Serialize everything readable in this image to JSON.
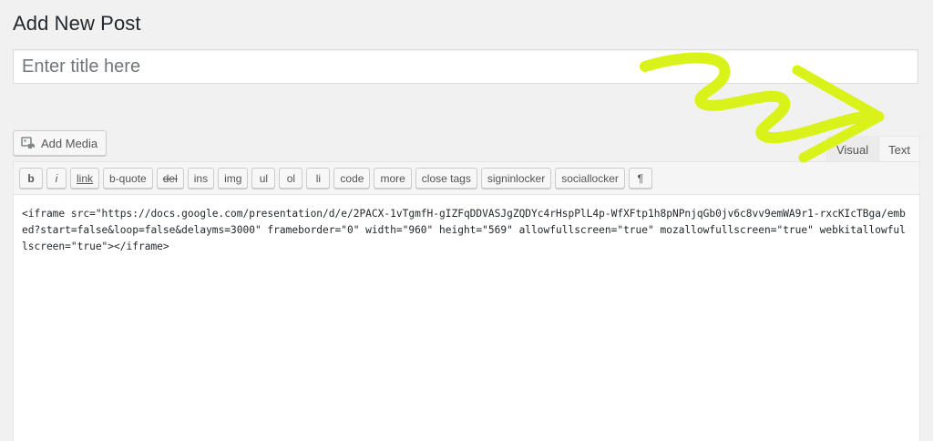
{
  "page": {
    "title": "Add New Post"
  },
  "title_field": {
    "placeholder": "Enter title here",
    "value": ""
  },
  "media": {
    "add_media_label": "Add Media",
    "icon": "media-icon"
  },
  "tabs": [
    {
      "label": "Visual",
      "active": false
    },
    {
      "label": "Text",
      "active": true
    }
  ],
  "quicktags": [
    {
      "label": "b",
      "style": "bold"
    },
    {
      "label": "i",
      "style": "ital"
    },
    {
      "label": "link",
      "style": "link"
    },
    {
      "label": "b-quote",
      "style": ""
    },
    {
      "label": "del",
      "style": "del"
    },
    {
      "label": "ins",
      "style": ""
    },
    {
      "label": "img",
      "style": ""
    },
    {
      "label": "ul",
      "style": "sq"
    },
    {
      "label": "ol",
      "style": "sq"
    },
    {
      "label": "li",
      "style": "sq"
    },
    {
      "label": "code",
      "style": ""
    },
    {
      "label": "more",
      "style": ""
    },
    {
      "label": "close tags",
      "style": ""
    },
    {
      "label": "signinlocker",
      "style": ""
    },
    {
      "label": "sociallocker",
      "style": ""
    },
    {
      "label": "¶",
      "style": "sq"
    }
  ],
  "editor": {
    "content": "<iframe src=\"https://docs.google.com/presentation/d/e/2PACX-1vTgmfH-gIZFqDDVASJgZQDYc4rHspPlL4p-WfXFtp1h8pNPnjqGb0jv6c8vv9emWA9r1-rxcKIcTBga/embed?start=false&loop=false&delayms=3000\" frameborder=\"0\" width=\"960\" height=\"569\" allowfullscreen=\"true\" mozallowfullscreen=\"true\" webkitallowfullscreen=\"true\"></iframe>"
  },
  "annotation": {
    "color": "#d9f21a",
    "icon": "arrow-scribble-icon"
  }
}
